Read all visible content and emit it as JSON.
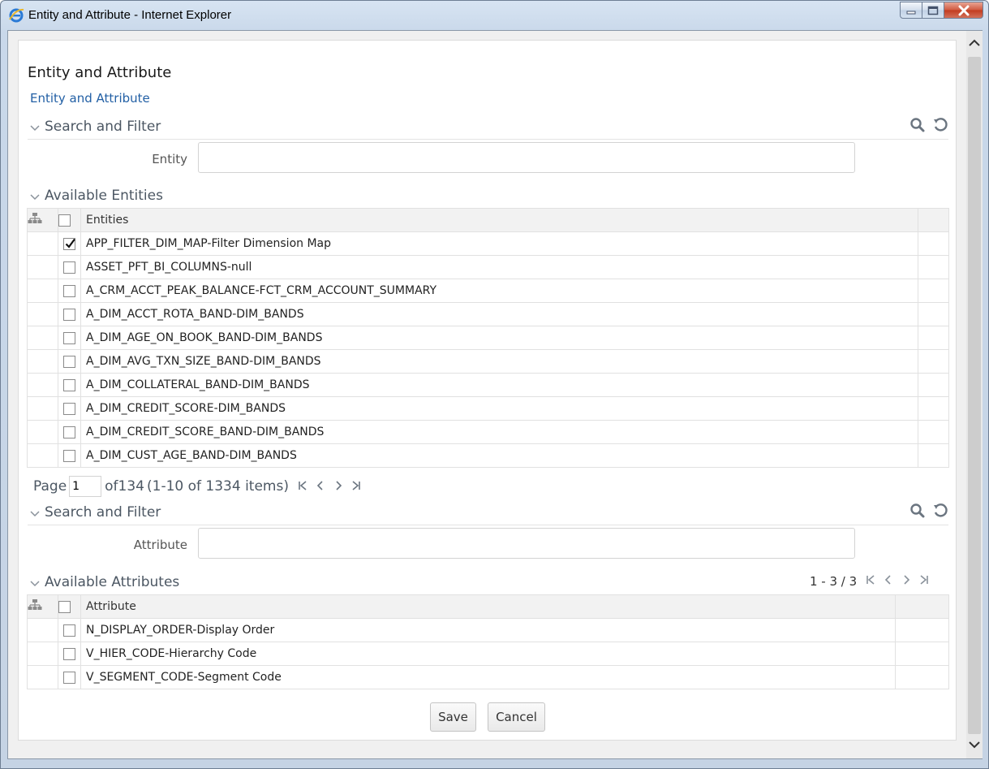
{
  "window": {
    "title": "Entity and Attribute - Internet Explorer"
  },
  "page": {
    "title": "Entity and Attribute",
    "breadcrumb": "Entity and Attribute"
  },
  "entity_filter": {
    "section_title": "Search and Filter",
    "field_label": "Entity",
    "field_value": ""
  },
  "entities": {
    "section_title": "Available Entities",
    "column_header": "Entities",
    "rows": [
      {
        "label": "APP_FILTER_DIM_MAP-Filter Dimension Map",
        "checked": true
      },
      {
        "label": "ASSET_PFT_BI_COLUMNS-null",
        "checked": false
      },
      {
        "label": "A_CRM_ACCT_PEAK_BALANCE-FCT_CRM_ACCOUNT_SUMMARY",
        "checked": false
      },
      {
        "label": "A_DIM_ACCT_ROTA_BAND-DIM_BANDS",
        "checked": false
      },
      {
        "label": "A_DIM_AGE_ON_BOOK_BAND-DIM_BANDS",
        "checked": false
      },
      {
        "label": "A_DIM_AVG_TXN_SIZE_BAND-DIM_BANDS",
        "checked": false
      },
      {
        "label": "A_DIM_COLLATERAL_BAND-DIM_BANDS",
        "checked": false
      },
      {
        "label": "A_DIM_CREDIT_SCORE-DIM_BANDS",
        "checked": false
      },
      {
        "label": "A_DIM_CREDIT_SCORE_BAND-DIM_BANDS",
        "checked": false
      },
      {
        "label": "A_DIM_CUST_AGE_BAND-DIM_BANDS",
        "checked": false
      }
    ],
    "pager": {
      "page_label": "Page",
      "page_value": "1",
      "of_label": "of",
      "total_pages": "134",
      "items_text": "(1-10 of 1334 items)"
    }
  },
  "attribute_filter": {
    "section_title": "Search and Filter",
    "field_label": "Attribute",
    "field_value": ""
  },
  "attributes": {
    "section_title": "Available Attributes",
    "range_text": "1 - 3 / 3",
    "column_header": "Attribute",
    "rows": [
      {
        "label": "N_DISPLAY_ORDER-Display Order",
        "checked": false
      },
      {
        "label": "V_HIER_CODE-Hierarchy Code",
        "checked": false
      },
      {
        "label": "V_SEGMENT_CODE-Segment Code",
        "checked": false
      }
    ]
  },
  "actions": {
    "save_label": "Save",
    "cancel_label": "Cancel"
  },
  "colors": {
    "link": "#2360a5",
    "section_text": "#4c5763",
    "icon": "#6b7580"
  }
}
